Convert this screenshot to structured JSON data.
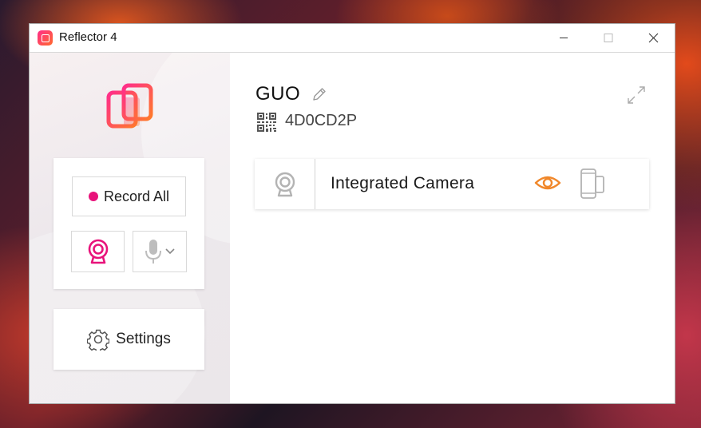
{
  "window": {
    "title": "Reflector 4"
  },
  "sidebar": {
    "record_all_label": "Record All",
    "settings_label": "Settings"
  },
  "device": {
    "name": "GUO",
    "code": "4D0CD2P"
  },
  "sources": [
    {
      "label": "Integrated Camera"
    }
  ],
  "colors": {
    "accent_pink": "#e8137b",
    "accent_orange": "#f0872a",
    "icon_gray": "#b3b3b3"
  },
  "icons": [
    "app-icon",
    "minimize-icon",
    "maximize-icon",
    "close-icon",
    "reflector-logo",
    "webcam-icon",
    "microphone-icon",
    "chevron-down-icon",
    "gear-icon",
    "pencil-icon",
    "qr-code-icon",
    "expand-icon",
    "eye-icon",
    "device-frame-icon"
  ]
}
